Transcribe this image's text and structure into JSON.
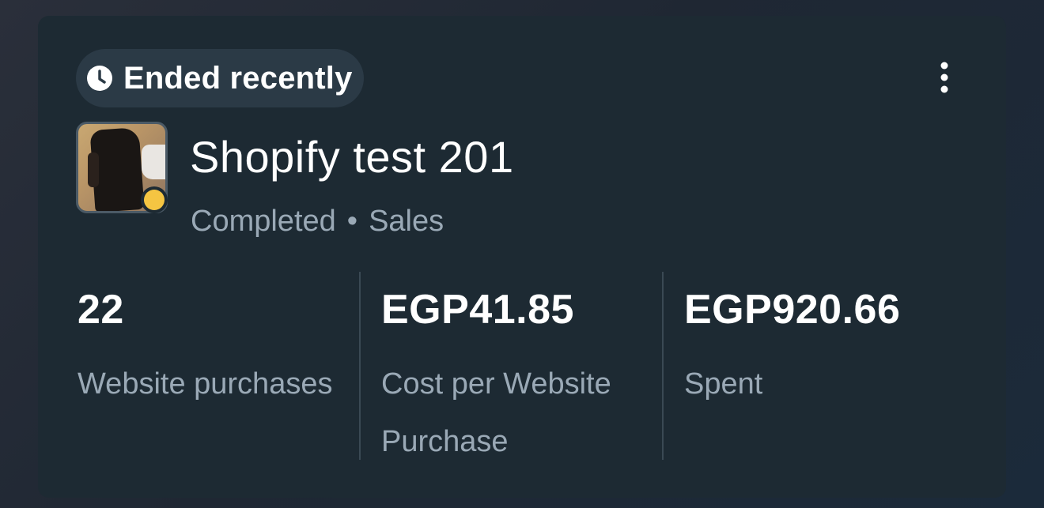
{
  "status": {
    "label": "Ended recently",
    "icon": "clock-icon"
  },
  "more_icon": "vertical-ellipsis-icon",
  "campaign": {
    "title": "Shopify test 201",
    "state": "Completed",
    "separator": "•",
    "objective": "Sales",
    "status_dot_color": "#f5c542"
  },
  "metrics": [
    {
      "value": "22",
      "caption": "Website purchases"
    },
    {
      "value": "EGP41.85",
      "caption": "Cost per Website Purchase"
    },
    {
      "value": "EGP920.66",
      "caption": "Spent"
    }
  ],
  "colors": {
    "card_bg": "#1d2a33",
    "pill_bg": "#2b3a46",
    "primary_text": "#ffffff",
    "secondary_text": "#9aa9b6",
    "divider": "#3a4954"
  }
}
